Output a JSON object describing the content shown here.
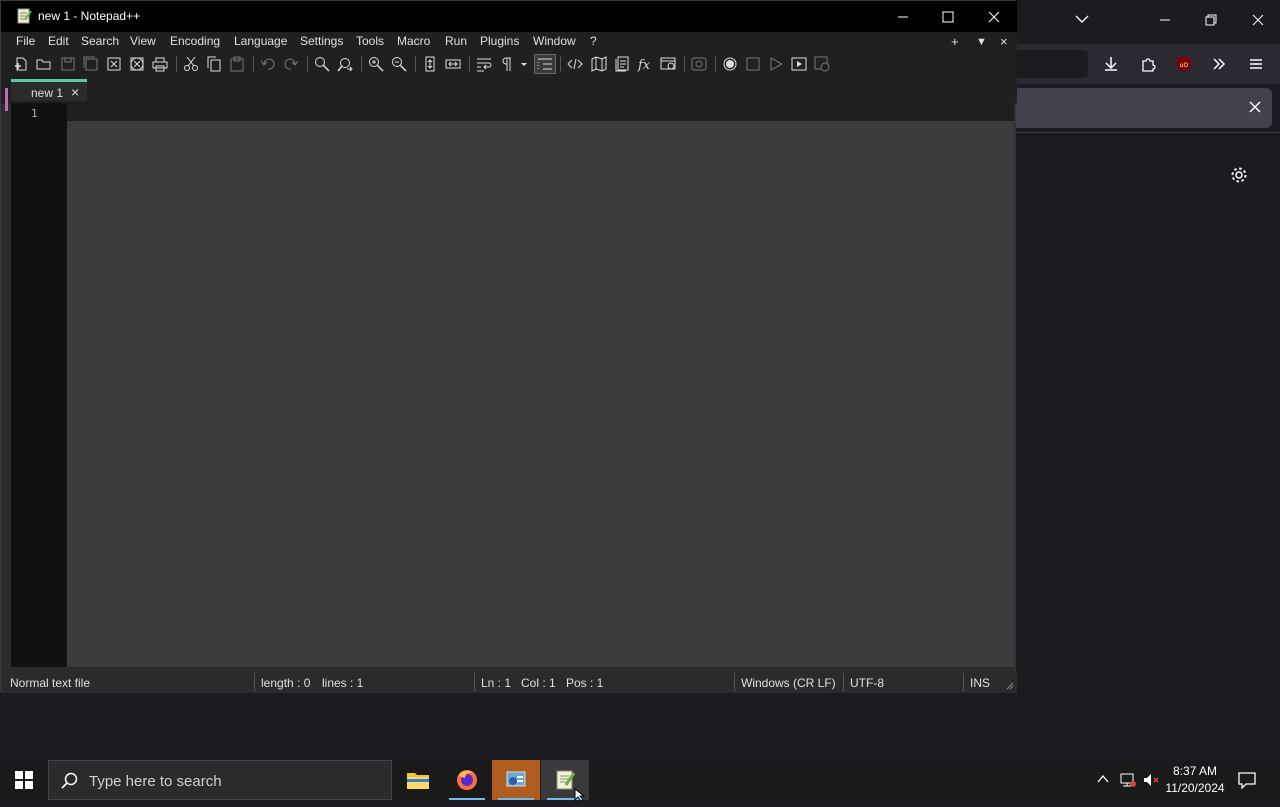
{
  "npp": {
    "title": "new 1 - Notepad++",
    "menu": [
      "File",
      "Edit",
      "Search",
      "View",
      "Encoding",
      "Language",
      "Settings",
      "Tools",
      "Macro",
      "Run",
      "Plugins",
      "Window",
      "?"
    ],
    "tab": {
      "label": "new 1"
    },
    "editor": {
      "line_number": "1"
    },
    "status": {
      "file_type": "Normal text file",
      "length": "length : 0",
      "lines": "lines : 1",
      "ln": "Ln : 1",
      "col": "Col : 1",
      "pos": "Pos : 1",
      "eol": "Windows (CR LF)",
      "encoding": "UTF-8",
      "mode": "INS"
    }
  },
  "taskbar": {
    "search_placeholder": "Type here to search",
    "time": "8:37 AM",
    "date": "11/20/2024"
  },
  "colors": {
    "tab_accent": "#5fc6a8",
    "taskbar_accent": "#76b9ed",
    "firefox_bg": "#1c1b22"
  }
}
